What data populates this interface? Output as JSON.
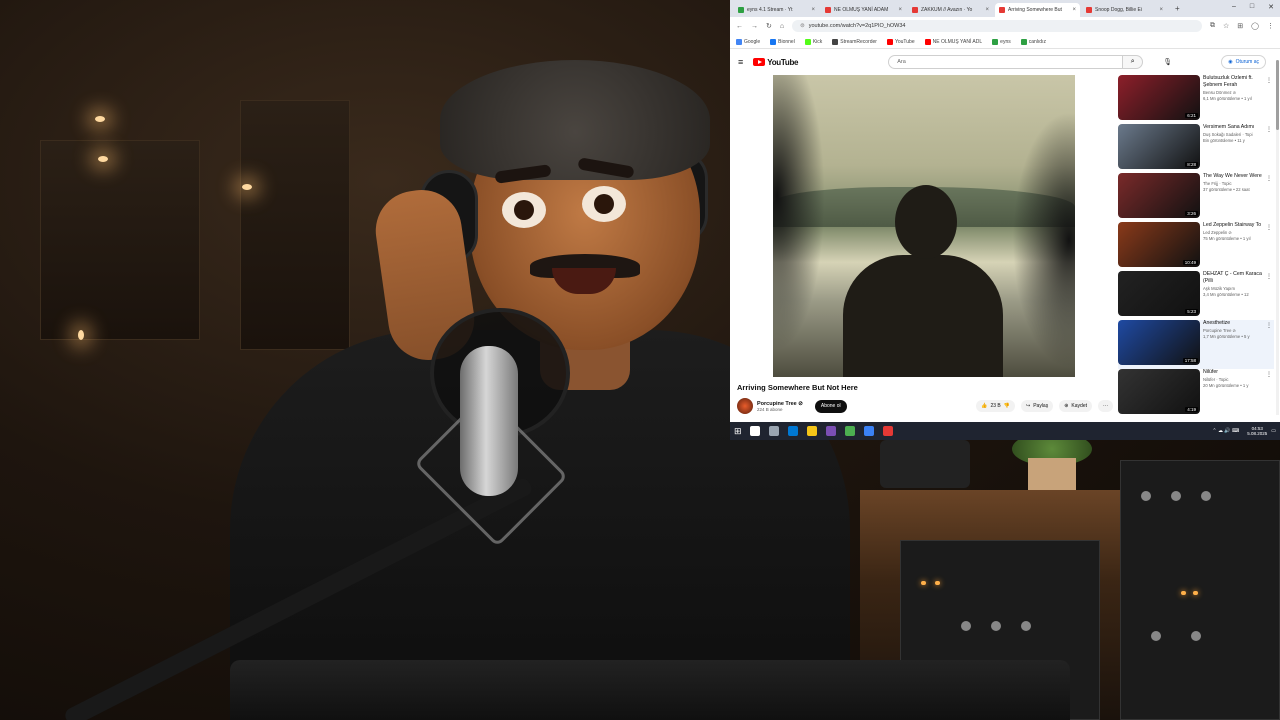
{
  "browser": {
    "tabs": [
      {
        "label": "eyns 4.1 Stream · Yt",
        "fav": "#2ea043",
        "active": false
      },
      {
        "label": "NE OLMUŞ YANİ ADAM",
        "fav": "#e53935",
        "active": false
      },
      {
        "label": "ZAKKUM // Avazın · Yo",
        "fav": "#e53935",
        "active": false
      },
      {
        "label": "Arriving Somewhere But",
        "fav": "#e53935",
        "active": true
      },
      {
        "label": "Snoop Dogg, Billie Ei",
        "fav": "#e53935",
        "active": false
      }
    ],
    "tab_close_glyph": "×",
    "new_tab_glyph": "+",
    "window_controls": [
      "–",
      "□",
      "✕"
    ],
    "nav_icons": [
      "←",
      "→",
      "↻",
      "⌂"
    ],
    "url": "youtube.com/watch?v=2q1PIO_hOW34",
    "addr_right_icons": [
      "⧉",
      "☆",
      "⊞",
      "◯",
      "⋮"
    ],
    "bookmarks": [
      {
        "label": "Google",
        "color": "#4285f4"
      },
      {
        "label": "Bionnel",
        "color": "#1877f2"
      },
      {
        "label": "Kick",
        "color": "#53fc18"
      },
      {
        "label": "StreamRecorder",
        "color": "#444444"
      },
      {
        "label": "YouTube",
        "color": "#ff0000"
      },
      {
        "label": "NE OLMUŞ YANİ ADL",
        "color": "#ff0000"
      },
      {
        "label": "eyns",
        "color": "#2ea043"
      },
      {
        "label": "canlıdız",
        "color": "#2ea043"
      }
    ]
  },
  "youtube": {
    "logo_text": "YouTube",
    "menu_icon": "≡",
    "search_placeholder": "Ara",
    "search_icon": "⌕",
    "mic_icon": "🎙",
    "signin_label": "Oturum aç",
    "video_title": "Arriving Somewhere But Not Here",
    "channel_name": "Porcupine Tree ⊘",
    "channel_subs": "224 B abone",
    "subscribe_label": "Abone ol",
    "like_label": "23 B",
    "share_label": "Paylaş",
    "save_label": "Kaydet",
    "more_label": "···",
    "like_icon": "👍",
    "dislike_icon": "👎",
    "share_icon": "↪",
    "save_icon": "⊕",
    "recommendations": [
      {
        "title": "Bulutsuzluk Özlemi ft. Şebnem Ferah",
        "channel": "Bensu Dönmez ⊘",
        "views": "6,1 Mn görüntüleme • 1 yıl",
        "duration": "6:21",
        "thumb": "#8d1f2a",
        "active": false
      },
      {
        "title": "Versimem Sana Adımı",
        "channel": "Duş Sokağı Sadaleri · Topi",
        "views": "Bin görüntüleme • 11 y",
        "duration": "8:28",
        "thumb": "#6b7a8c",
        "active": false
      },
      {
        "title": "The Way We Never Were",
        "channel": "The Frijj · Topic",
        "views": "37 görüntüleme • 22 saat",
        "duration": "3:26",
        "thumb": "#7a2a2a",
        "active": false
      },
      {
        "title": "Led Zeppelin Stairway To",
        "channel": "Led Zeppelin ⊘",
        "views": "75 Mn görüntüleme • 1 yıl",
        "duration": "10:49",
        "thumb": "#8a3a1a",
        "active": false
      },
      {
        "title": "DEHZAT Ç - Cem Karaca (Pilli",
        "channel": "Aşk Müzik Yapım",
        "views": "3,4 Mn görüntüleme • 12",
        "duration": "5:23",
        "thumb": "#222222",
        "active": false
      },
      {
        "title": "Anesthetize",
        "channel": "Porcupine Tree ⊘",
        "views": "1,7 Mn görüntüleme • 5 y",
        "duration": "17:58",
        "thumb": "#1f4aa3",
        "active": true
      },
      {
        "title": "Nilüfer",
        "channel": "Nilüfer · Topic",
        "views": "20 Mn görüntüleme • 1 y",
        "duration": "4:19",
        "thumb": "#333333",
        "active": false
      }
    ],
    "rec_more_icon": "⋮"
  },
  "taskbar": {
    "start_icon": "⊞",
    "icons": [
      "#ffffff",
      "#9aa5b1",
      "#0078d4",
      "#f5c518",
      "#7b4fb4",
      "#4caf50",
      "#3b82f6",
      "#e53935"
    ],
    "tray": "⌃ ☁ 🔊 ⌨",
    "time": "04:53",
    "date": "5.08.2025"
  }
}
